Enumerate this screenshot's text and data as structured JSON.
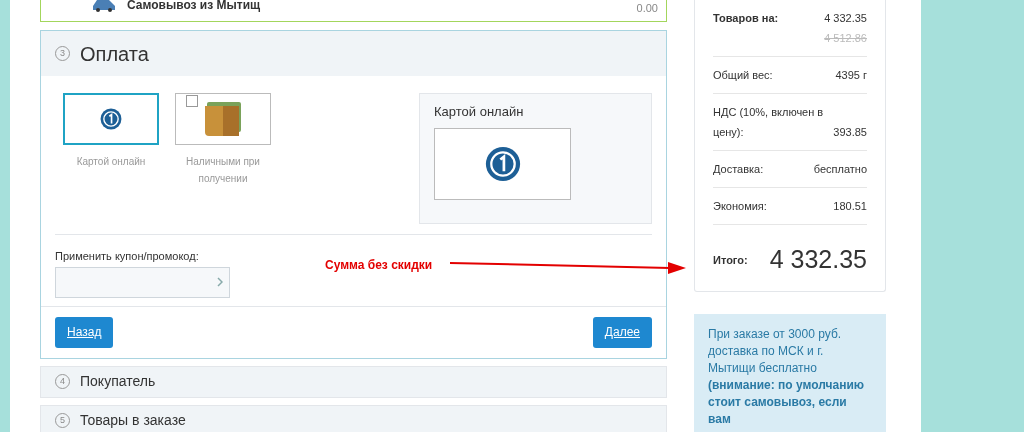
{
  "delivery": {
    "name": "Самовывоз из Мытищ",
    "price": "0.00"
  },
  "payment": {
    "step": "3",
    "title": "Оплата",
    "options": [
      {
        "kind": "card",
        "label": "Картой онлайн",
        "selected": true
      },
      {
        "kind": "cash",
        "label": "Наличными при получении",
        "selected": false
      }
    ],
    "preview_title": "Картой онлайн",
    "coupon_label": "Применить купон/промокод:",
    "back": "Назад",
    "next": "Далее"
  },
  "annotation": "Сумма без скидки",
  "sections": [
    {
      "step": "4",
      "title": "Покупатель"
    },
    {
      "step": "5",
      "title": "Товары в заказе"
    }
  ],
  "summary": {
    "rows": [
      {
        "label": "Товаров на:",
        "value": "4 332.35",
        "old_value": "4 512.86",
        "bold": true
      },
      {
        "label": "Общий вес:",
        "value": "4395 г",
        "bold": false
      },
      {
        "label": "НДС (10%, включен в цену):",
        "value": "393.85",
        "bold": false
      },
      {
        "label": "Доставка:",
        "value": "бесплатно",
        "bold": false
      },
      {
        "label": "Экономия:",
        "value": "180.51",
        "bold": false
      }
    ],
    "total_label": "Итого:",
    "total_value": "4 332.35"
  },
  "info": "При заказе от 3000 руб. доставка по МСК и г. Мытищи бесплатно **(внимание: по умолчанию стоит самовывоз, если вам**"
}
